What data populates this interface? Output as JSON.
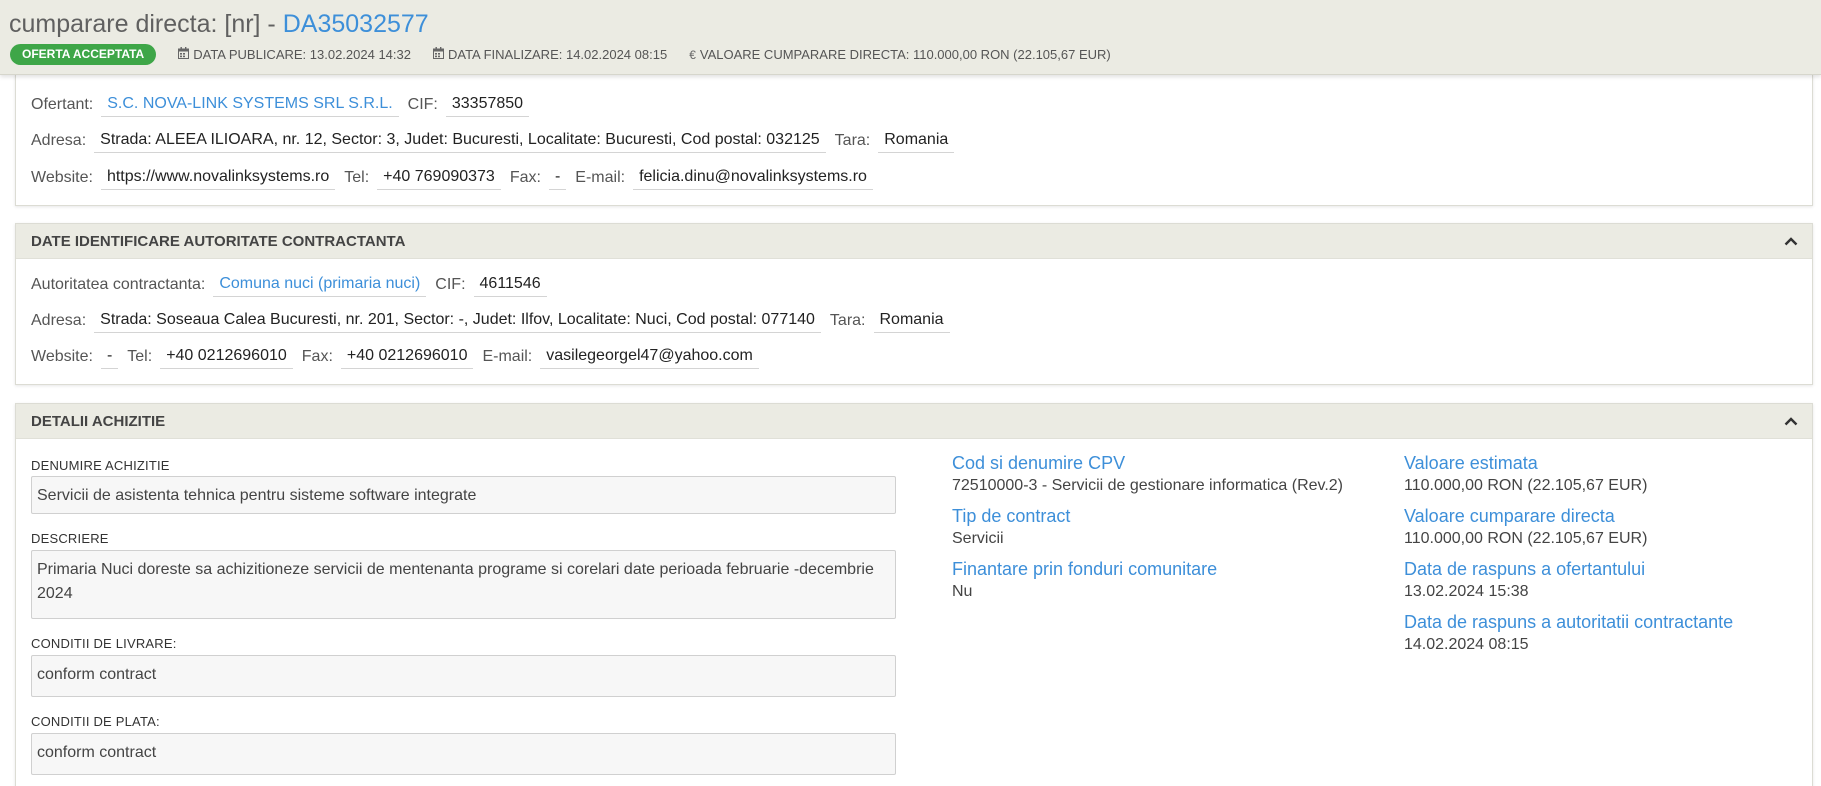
{
  "header": {
    "title_prefix": "cumparare directa: [nr] - ",
    "number": "DA35032577",
    "badge": "OFERTA ACCEPTATA",
    "data_publicare": "DATA PUBLICARE: 13.02.2024 14:32",
    "data_finalizare": "DATA FINALIZARE: 14.02.2024 08:15",
    "valoare": "VALOARE CUMPARARE DIRECTA: 110.000,00  RON (22.105,67  EUR)",
    "icons": {
      "calendar": "calendar-icon",
      "euro": "euro-icon"
    },
    "colors": {
      "accent": "#3d8fd9",
      "badge": "#3ea648",
      "header_bg": "#ebebe3"
    }
  },
  "ofertant": {
    "label": "Ofertant:",
    "name": "S.C. NOVA-LINK SYSTEMS SRL S.R.L.",
    "cif_label": "CIF:",
    "cif": "33357850",
    "adresa_label": "Adresa:",
    "adresa": "Strada: ALEEA ILIOARA, nr. 12, Sector: 3, Judet: Bucuresti, Localitate: Bucuresti, Cod postal: 032125",
    "tara_label": "Tara:",
    "tara": "Romania",
    "website_label": "Website:",
    "website": "https://www.novalinksystems.ro",
    "tel_label": "Tel:",
    "tel": "+40 769090373",
    "fax_label": "Fax:",
    "fax": "-",
    "email_label": "E-mail:",
    "email": "felicia.dinu@novalinksystems.ro"
  },
  "autoritate": {
    "title": "DATE IDENTIFICARE AUTORITATE CONTRACTANTA",
    "label": "Autoritatea contractanta:",
    "name": "Comuna nuci (primaria nuci)",
    "cif_label": "CIF:",
    "cif": "4611546",
    "adresa_label": "Adresa:",
    "adresa": "Strada: Soseaua Calea Bucuresti, nr. 201, Sector: -, Judet: Ilfov, Localitate: Nuci, Cod postal: 077140",
    "tara_label": "Tara:",
    "tara": "Romania",
    "website_label": "Website:",
    "website": "-",
    "tel_label": "Tel:",
    "tel": "+40 0212696010",
    "fax_label": "Fax:",
    "fax": "+40 0212696010",
    "email_label": "E-mail:",
    "email": "vasilegeorgel47@yahoo.com"
  },
  "detalii": {
    "title": "DETALII ACHIZITIE",
    "denumire_label": "DENUMIRE ACHIZITIE",
    "denumire": "Servicii de asistenta tehnica pentru sisteme software integrate",
    "descriere_label": "DESCRIERE",
    "descriere": "Primaria Nuci doreste sa achizitioneze servicii de mentenanta programe si corelari date perioada februarie -decembrie 2024",
    "livrare_label": "CONDITII DE LIVRARE:",
    "livrare": "conform contract",
    "plata_label": "CONDITII DE PLATA:",
    "plata": "conform contract",
    "cpv_key": "Cod si denumire CPV",
    "cpv_val": "72510000-3 - Servicii de gestionare informatica (Rev.2)",
    "tip_key": "Tip de contract",
    "tip_val": "Servicii",
    "finantare_key": "Finantare prin fonduri comunitare",
    "finantare_val": "Nu",
    "estimata_key": "Valoare estimata",
    "estimata_val": "110.000,00  RON (22.105,67  EUR)",
    "cumparare_key": "Valoare cumparare directa",
    "cumparare_val": "110.000,00  RON (22.105,67  EUR)",
    "raspuns_of_key": "Data de raspuns a ofertantului",
    "raspuns_of_val": "13.02.2024 15:38",
    "raspuns_aut_key": "Data de raspuns a autoritatii contractante",
    "raspuns_aut_val": "14.02.2024 08:15"
  }
}
